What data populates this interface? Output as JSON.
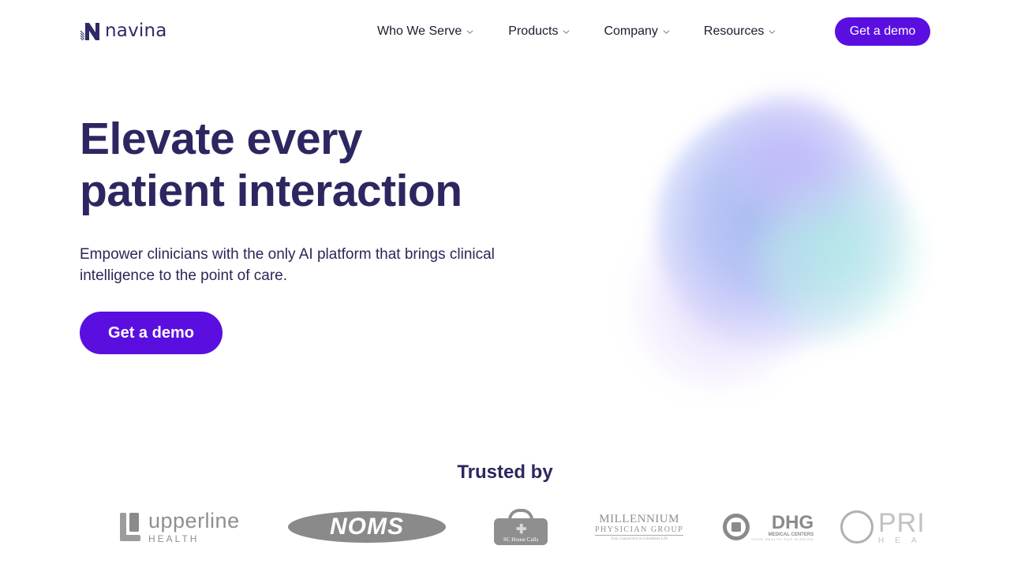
{
  "header": {
    "brand_name": "navina",
    "nav_items": [
      {
        "label": "Who We Serve",
        "icon": "chevron-down-icon"
      },
      {
        "label": "Products",
        "icon": "chevron-down-icon"
      },
      {
        "label": "Company",
        "icon": "chevron-down-icon"
      },
      {
        "label": "Resources",
        "icon": "chevron-down-icon"
      }
    ],
    "cta_label": "Get a demo"
  },
  "hero": {
    "title_line1": "Elevate every",
    "title_line2": "patient interaction",
    "subtitle": "Empower clinicians with the only AI platform that brings clinical intelligence to the point of care.",
    "cta_label": "Get a demo"
  },
  "trusted": {
    "title": "Trusted by",
    "logos": [
      {
        "name": "upperline",
        "line1": "upperline",
        "line2": "HEALTH"
      },
      {
        "name": "noms",
        "line1": "NOMS"
      },
      {
        "name": "sc-house-calls",
        "line1": "SC House Calls"
      },
      {
        "name": "millennium",
        "line1": "MILLENNIUM",
        "line2": "PHYSICIAN GROUP",
        "line3": "Your Connection to a Healthier Life"
      },
      {
        "name": "dhg",
        "line1": "DHG",
        "line2": "MEDICAL CENTERS",
        "line3": "YOUR HEALTH OUR MISSION"
      },
      {
        "name": "privia",
        "line1": "PRI",
        "line2": "HEA"
      }
    ]
  },
  "colors": {
    "accent": "#5a0fe0",
    "heading": "#2c2760",
    "text": "#2b2757",
    "logo_gray": "#8f8f8f"
  }
}
